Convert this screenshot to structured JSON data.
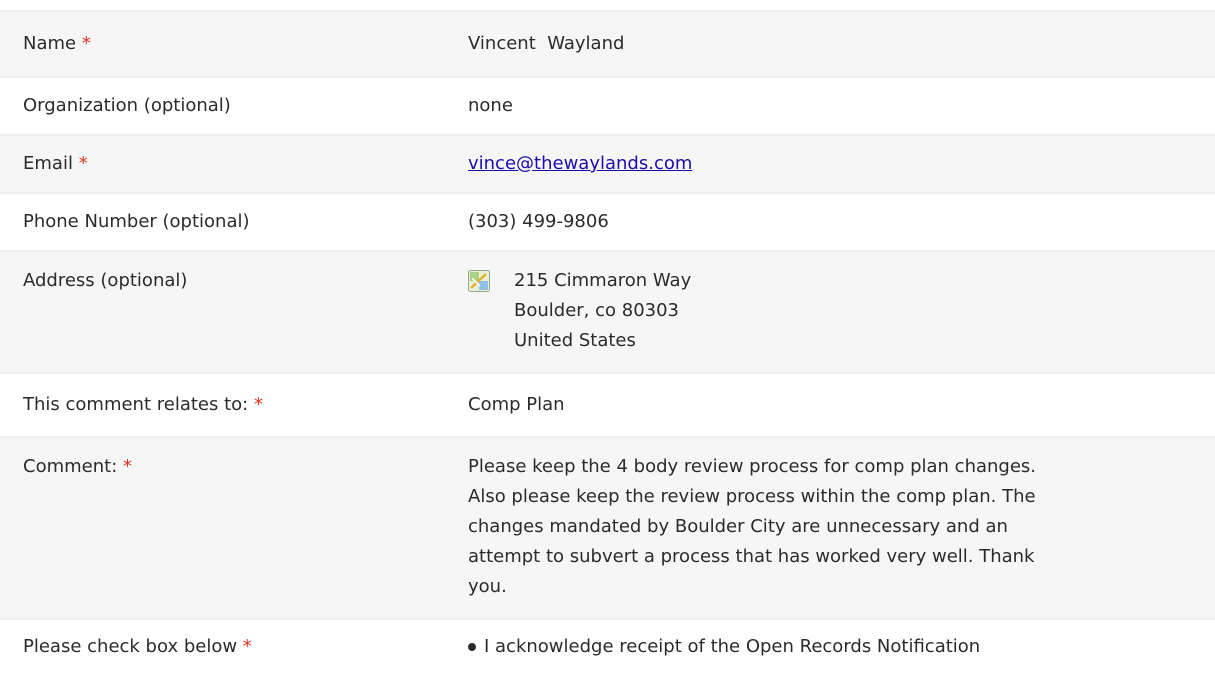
{
  "required_marker": "*",
  "fields": [
    {
      "label": "Name",
      "value": "Vincent  Wayland"
    },
    {
      "label": "Organization (optional)",
      "value": "none"
    },
    {
      "label": "Email",
      "value": "vince@thewaylands.com"
    },
    {
      "label": "Phone Number (optional)",
      "value": "(303) 499-9806"
    },
    {
      "label": "Address (optional)",
      "address_lines": [
        "215 Cimmaron Way",
        "Boulder, co 80303",
        "United States"
      ],
      "icon": "map-icon"
    },
    {
      "label": "This comment relates to:",
      "value": "Comp Plan"
    },
    {
      "label": "Comment:",
      "value": "Please keep the 4 body review process for comp plan changes. Also please keep the review process within the comp plan. The changes mandated by Boulder City are unnecessary and an attempt to subvert a process that has worked very well. Thank you."
    },
    {
      "label": "Please check box below",
      "items": [
        "I acknowledge receipt of the Open Records Notification"
      ]
    }
  ],
  "colors": {
    "required": "#e2311d",
    "link": "#1a0dab",
    "row_shade": "#f6f6f6",
    "divider": "#f0f0f0"
  }
}
